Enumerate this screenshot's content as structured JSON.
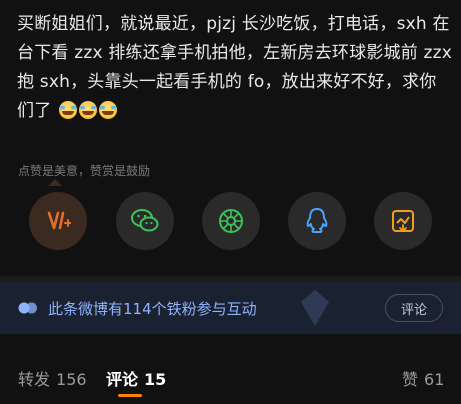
{
  "post": {
    "text": "买断姐姐们，就说最近，pjzj 长沙吃饭，打电话，sxh 在台下看 zzx 排练还拿手机拍他，左新房去环球影城前 zzx 抱 sxh，头靠头一起看手机的 fo，放出来好不好，求你们了",
    "emoji_count": 3
  },
  "reward_tip": "点赞是美意，赞赏是鼓励",
  "share_buttons": [
    {
      "name": "reward-icon",
      "color": "#e0702a"
    },
    {
      "name": "wechat-icon",
      "color": "#3cc25b"
    },
    {
      "name": "moments-icon",
      "color": "#3cc25b"
    },
    {
      "name": "qq-icon",
      "color": "#4aa3ff"
    },
    {
      "name": "save-image-icon",
      "color": "#f0a020"
    }
  ],
  "fan_banner": {
    "text": "此条微博有114个铁粉参与互动",
    "button_label": "评论"
  },
  "tabs": [
    {
      "label": "转发",
      "count": "156"
    },
    {
      "label": "评论",
      "count": "15"
    },
    {
      "label": "赞",
      "count": "61"
    }
  ],
  "colors": {
    "accent": "#ff8200",
    "banner_text": "#8fb4ff",
    "background": "#111111"
  }
}
